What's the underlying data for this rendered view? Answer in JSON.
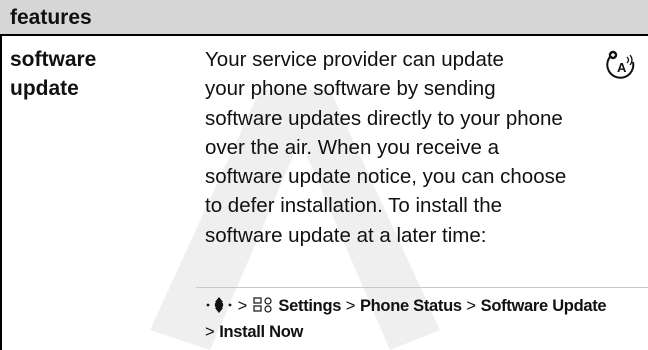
{
  "header": {
    "title": "features"
  },
  "feature": {
    "term_line1": "software",
    "term_line2": "update",
    "description_lines": [
      "Your service provider can update",
      "your phone software by sending",
      "software updates directly to your phone",
      "over the air. When you receive a",
      "software update notice, you can choose",
      "to defer installation. To install the",
      "software update at a later time:"
    ]
  },
  "path": {
    "separator": ">",
    "step_settings": "Settings",
    "step_phone_status": "Phone Status",
    "step_software_update": "Software Update",
    "step_install_now": "Install Now"
  },
  "icons": {
    "ota": "network-feature-icon",
    "nav": "navigation-key-icon",
    "settings": "settings-icon"
  }
}
